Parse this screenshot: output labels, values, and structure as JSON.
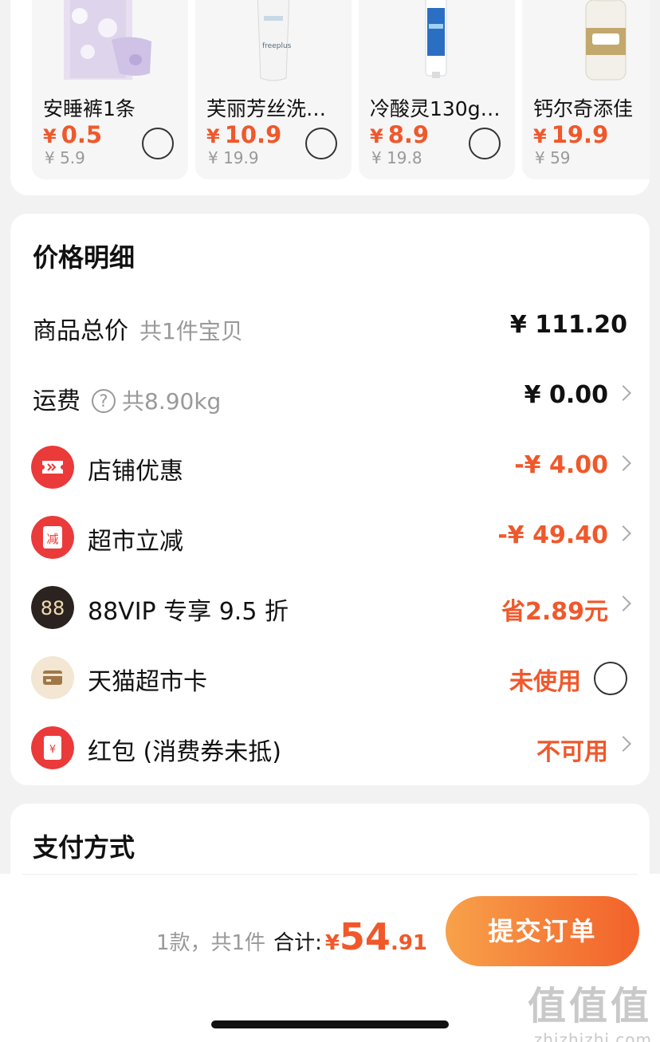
{
  "products": [
    {
      "name": "安睡裤1条",
      "currency": "¥",
      "price": "0.5",
      "original": "¥ 5.9"
    },
    {
      "name": "芙丽芳丝洗…",
      "currency": "¥",
      "price": "10.9",
      "original": "¥ 19.9"
    },
    {
      "name": "冷酸灵130g …",
      "currency": "¥",
      "price": "8.9",
      "original": "¥ 19.8"
    },
    {
      "name": "钙尔奇添佳",
      "currency": "¥",
      "price": "19.9",
      "original": "¥ 59"
    }
  ],
  "price_detail": {
    "title": "价格明细",
    "goods_total": {
      "label": "商品总价",
      "sub": "共1件宝贝",
      "value": "¥ 111.20"
    },
    "shipping": {
      "label": "运费",
      "help": "?",
      "sub": "共8.90kg",
      "value": "¥ 0.00"
    },
    "store_discount": {
      "label": "店铺优惠",
      "value": "-¥ 4.00"
    },
    "market_discount": {
      "label": "超市立减",
      "icon_text": "减",
      "value": "-¥ 49.40"
    },
    "vip": {
      "label": "88VIP 专享 9.5 折",
      "icon_text": "88",
      "value": "省2.89元"
    },
    "market_card": {
      "label": "天猫超市卡",
      "value": "未使用"
    },
    "red_packet": {
      "label": "红包 (消费券未抵)",
      "icon_text": "¥",
      "value": "不可用"
    }
  },
  "payment": {
    "title": "支付方式"
  },
  "bottom_bar": {
    "count_text": "1款，共1件",
    "total_label": "合计:",
    "currency": "¥",
    "total_int": "54",
    "total_dec": ".91",
    "submit_label": "提交订单"
  },
  "watermark": {
    "main": "值值值",
    "site": "zhizhizhi.com"
  },
  "colors": {
    "accent": "#f0582b",
    "button_start": "#f8a14a",
    "button_end": "#f2612a"
  }
}
